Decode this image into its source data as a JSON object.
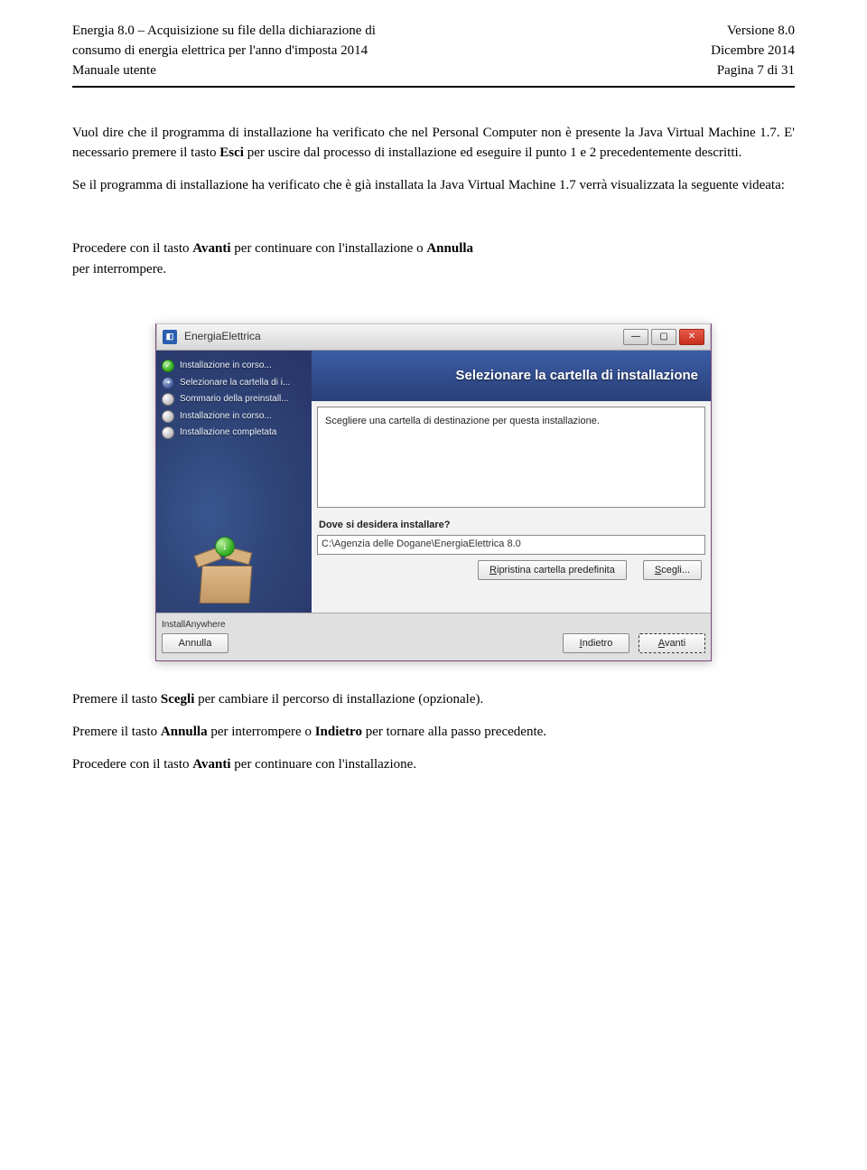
{
  "header": {
    "top_left_line1": "Energia 8.0 – Acquisizione su file della dichiarazione di",
    "top_left_line2": "consumo di energia elettrica per l'anno d'imposta 2014",
    "top_left_line3": "Manuale utente",
    "top_right_line1": "Versione 8.0",
    "top_right_line2": "Dicembre 2014",
    "top_right_line3": "Pagina 7 di 31"
  },
  "body": {
    "p1_pre": "Vuol dire che il programma di installazione ha verificato che nel Personal Computer non è presente la Java Virtual Machine 1.7. E' necessario premere il tasto ",
    "p1_bold": "Esci",
    "p1_post": " per uscire dal processo di installazione ed eseguire il punto 1 e 2 precedentemente descritti.",
    "p2": "Se il programma di installazione ha verificato che è già installata la Java Virtual Machine 1.7 verrà visualizzata la seguente videata:",
    "p3_pre": "Procedere con il tasto ",
    "p3_b1": "Avanti",
    "p3_mid": " per continuare con l'installazione o ",
    "p3_b2": "Annulla",
    "p4": "per interrompere.",
    "p5_pre": "Premere il tasto ",
    "p5_b": "Scegli",
    "p5_post": " per cambiare il percorso di installazione (opzionale).",
    "p6_pre": "Premere il tasto ",
    "p6_b1": "Annulla",
    "p6_mid": " per interrompere o ",
    "p6_b2": "Indietro",
    "p6_post": " per tornare alla passo precedente.",
    "p7_pre": "Procedere con il tasto ",
    "p7_b": "Avanti",
    "p7_post": " per continuare con l'installazione."
  },
  "installer": {
    "title": "EnergiaElettrica",
    "banner": "Selezionare la cartella di installazione",
    "steps": [
      {
        "label": "Installazione in corso...",
        "state": "done"
      },
      {
        "label": "Selezionare la cartella di i...",
        "state": "arrow"
      },
      {
        "label": "Sommario della preinstall...",
        "state": "idle"
      },
      {
        "label": "Installazione in corso...",
        "state": "idle"
      },
      {
        "label": "Installazione completata",
        "state": "idle"
      }
    ],
    "desc": "Scegliere una cartella di destinazione per questa installazione.",
    "path_label": "Dove si desidera installare?",
    "path_value": "C:\\Agenzia delle Dogane\\EnergiaElettrica 8.0",
    "btn_restore": "Ripristina cartella predefinita",
    "btn_restore_u": "R",
    "btn_choose": "Scegli...",
    "btn_choose_u": "S",
    "ia_label": "InstallAnywhere",
    "btn_cancel": "Annulla",
    "btn_back": "Indietro",
    "btn_back_u": "I",
    "btn_next": "Avanti",
    "btn_next_u": "A"
  }
}
